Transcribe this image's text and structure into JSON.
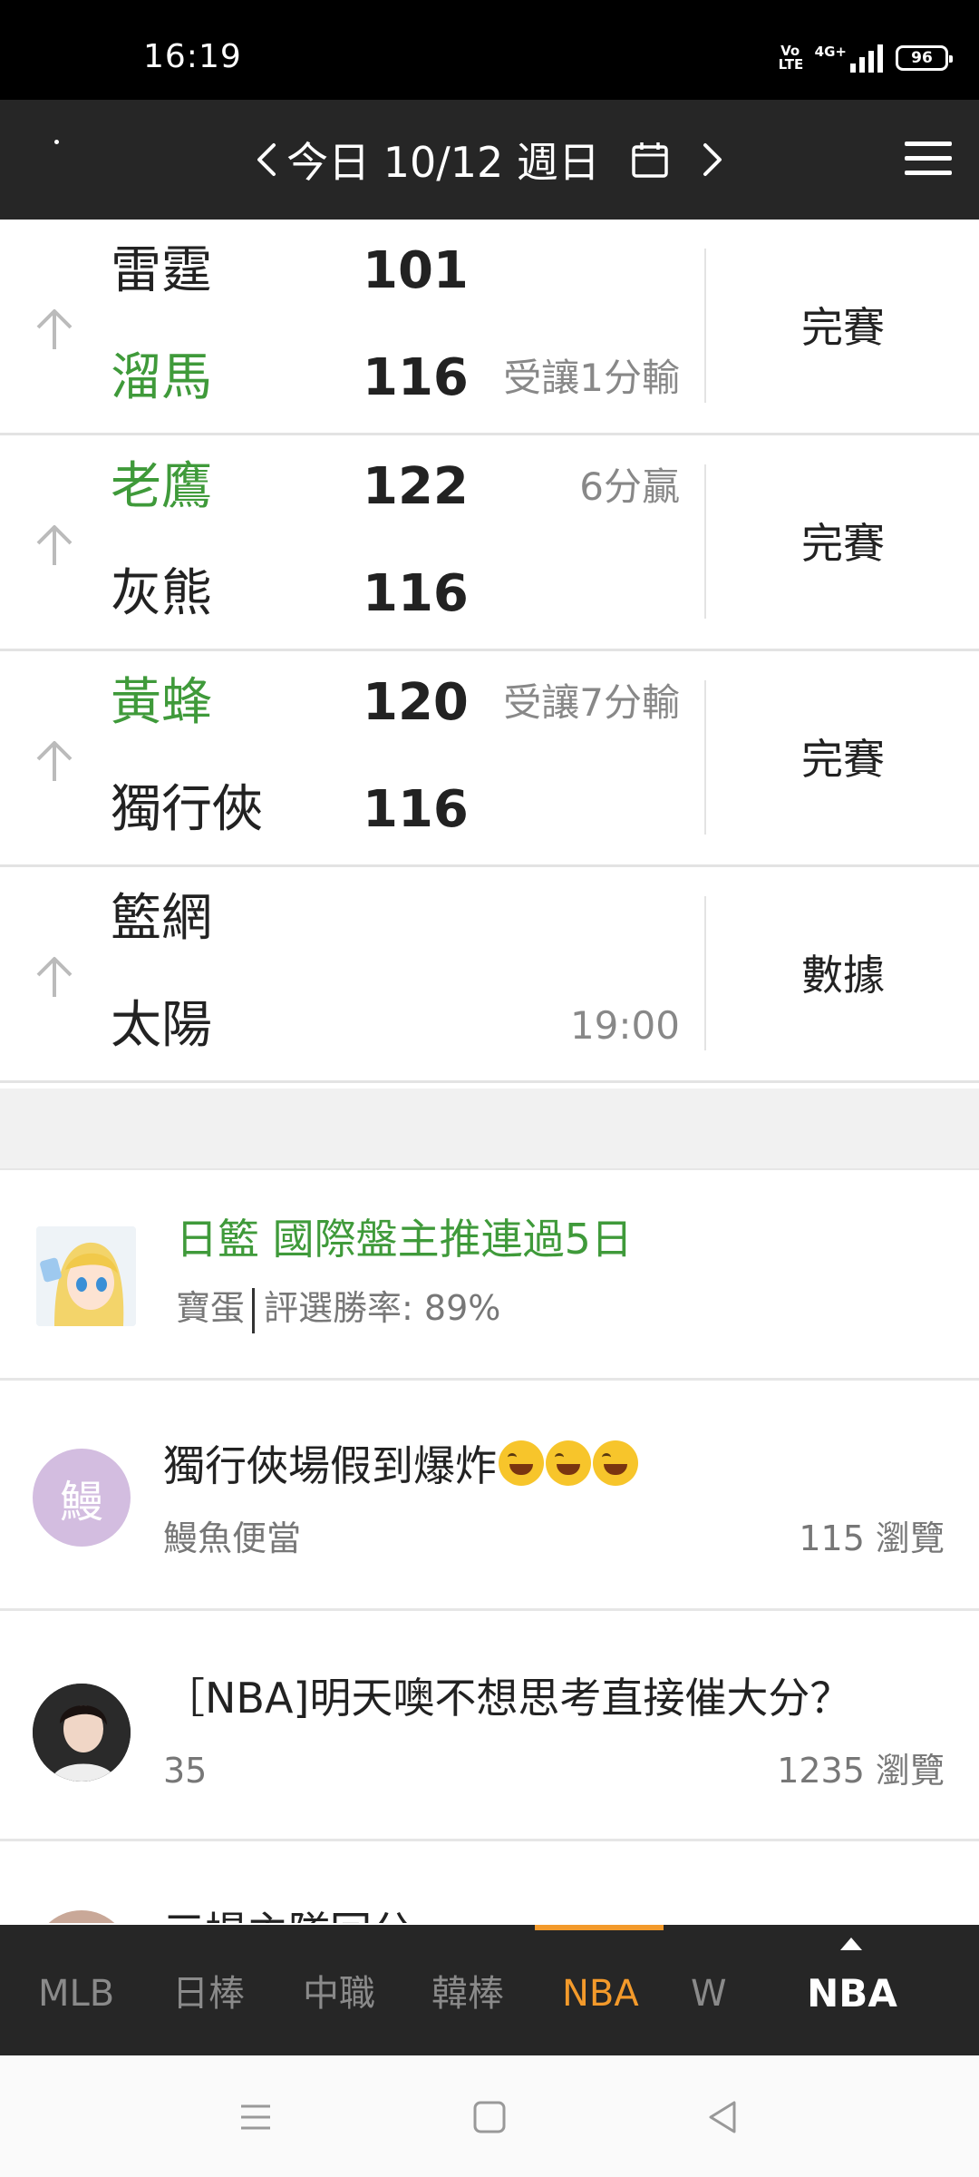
{
  "status_bar": {
    "time": "16:19",
    "volte": "Vo LTE",
    "network": "4G+",
    "battery": "96"
  },
  "header": {
    "date_title": "今日 10/12 週日",
    "icons": [
      "prev-day-icon",
      "calendar-icon",
      "next-day-icon",
      "menu-icon"
    ]
  },
  "games": [
    {
      "team1": "雷霆",
      "score1": "101",
      "note1": "",
      "team2": "溜馬",
      "score2": "116",
      "note2": "受讓1分輸",
      "winner": 2,
      "status": "完賽"
    },
    {
      "team1": "老鷹",
      "score1": "122",
      "note1": "6分贏",
      "team2": "灰熊",
      "score2": "116",
      "note2": "",
      "winner": 1,
      "status": "完賽"
    },
    {
      "team1": "黃蜂",
      "score1": "120",
      "note1": "受讓7分輸",
      "team2": "獨行俠",
      "score2": "116",
      "note2": "",
      "winner": 1,
      "status": "完賽"
    },
    {
      "team1": "籃網",
      "score1": "",
      "note1": "",
      "team2": "太陽",
      "score2": "",
      "note2": "19:00",
      "winner": 0,
      "status": "數據"
    }
  ],
  "posts": [
    {
      "title": "日籃 國際盤主推連過5日",
      "author": "寶蛋",
      "winrate": "評選勝率: 89%"
    },
    {
      "avatar_char": "鰻",
      "title": "獨行俠場假到爆炸",
      "author": "鰻魚便當",
      "views": "115 瀏覽"
    },
    {
      "title": "［NBA]明天噢不想思考直接催大分？",
      "author": "35",
      "views": "1235 瀏覽"
    },
    {
      "title": "三場主隊回分"
    }
  ],
  "tabs": {
    "items": [
      "MLB",
      "日棒",
      "中職",
      "韓棒",
      "NBA",
      "W"
    ],
    "active": "NBA",
    "current": "NBA",
    "accent_color": "#f39a2b"
  },
  "colors": {
    "win_green": "#3f9a3a",
    "header_bg": "#262626"
  }
}
